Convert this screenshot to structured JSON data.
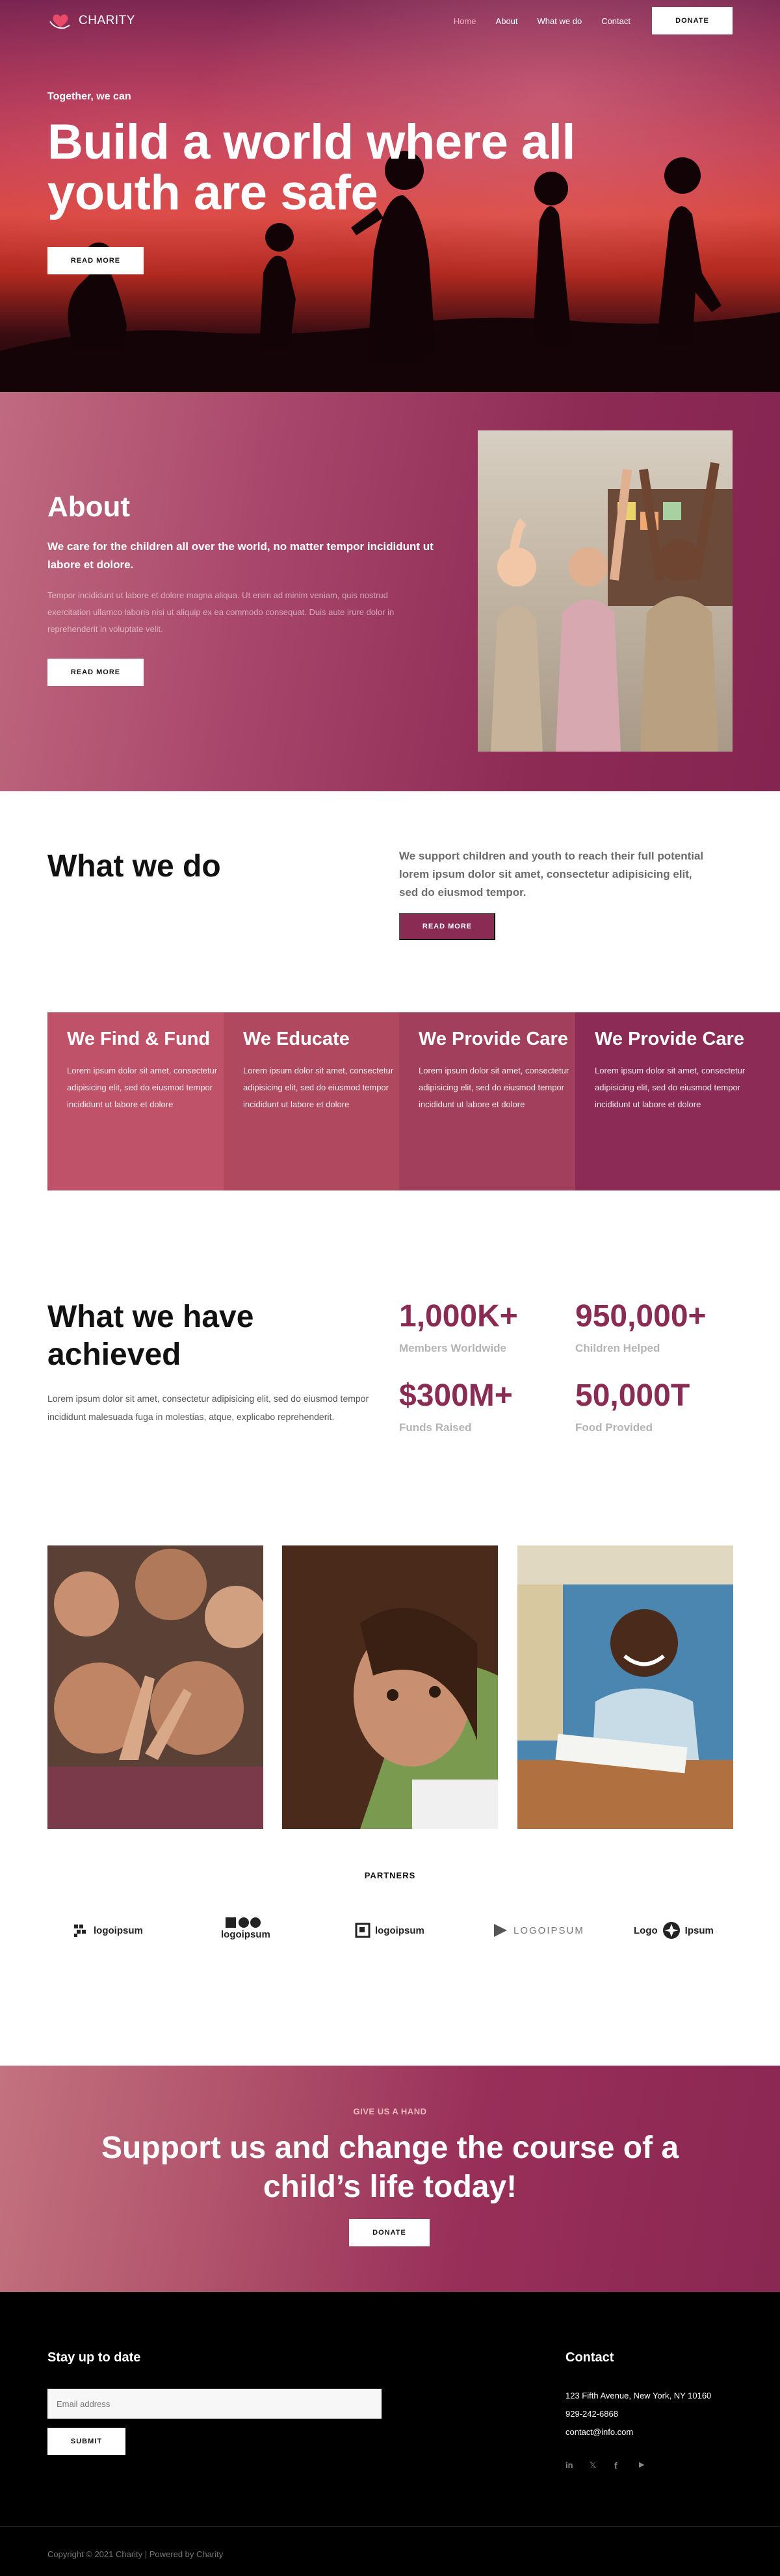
{
  "nav": {
    "logo_text": "CHARITY",
    "links": [
      "Home",
      "About",
      "What we do",
      "Contact"
    ],
    "donate_label": "DONATE"
  },
  "hero": {
    "eyebrow": "Together, we can",
    "title": "Build a world where all youth are safe",
    "button_label": "READ MORE"
  },
  "about": {
    "title": "About",
    "lead": "We care for the children all over the world, no matter tempor incididunt ut labore et dolore.",
    "body": "Tempor incididunt ut labore et dolore magna aliqua. Ut enim ad minim veniam, quis nostrud exercitation ullamco laboris nisi ut aliquip ex ea commodo consequat. Duis aute irure dolor in reprehenderit in voluptate velit.",
    "button_label": "READ MORE"
  },
  "what_we_do": {
    "title": "What we do",
    "text": "We support children and youth to reach their full potential lorem ipsum dolor sit amet, consectetur adipisicing elit, sed do eiusmod tempor.",
    "button_label": "READ MORE"
  },
  "services": [
    {
      "title": "We Find & Fund",
      "text": "Lorem ipsum dolor sit amet, consectetur adipisicing elit, sed do eiusmod tempor incididunt ut labore et dolore",
      "color": "#bf5169"
    },
    {
      "title": "We Educate",
      "text": "Lorem ipsum dolor sit amet, consectetur adipisicing elit, sed do eiusmod tempor incididunt ut labore et dolore",
      "color": "#b0495f"
    },
    {
      "title": "We Provide Care",
      "text": "Lorem ipsum dolor sit amet, consectetur adipisicing elit, sed do eiusmod tempor incididunt ut labore et dolore",
      "color": "#a23f5d"
    },
    {
      "title": "We Provide Care",
      "text": "Lorem ipsum dolor sit amet, consectetur adipisicing elit, sed do eiusmod tempor incididunt ut labore et dolore",
      "color": "#8c2b55"
    }
  ],
  "achieved": {
    "title": "What we have achieved",
    "text": "Lorem ipsum dolor sit amet, consectetur adipisicing elit, sed do eiusmod tempor incididunt malesuada fuga in molestias, atque, explicabo reprehenderit.",
    "stats": [
      {
        "value": "1,000K+",
        "label": "Members Worldwide"
      },
      {
        "value": "950,000+",
        "label": "Children Helped"
      },
      {
        "value": "$300M+",
        "label": "Funds Raised"
      },
      {
        "value": "50,000T",
        "label": "Food Provided"
      }
    ]
  },
  "partners": {
    "title": "PARTNERS",
    "logos": [
      "logoipsum",
      "logoipsum",
      "logoipsum",
      "LOGOIPSUM",
      "Ipsum"
    ]
  },
  "cta": {
    "eyebrow": "GIVE US A HAND",
    "title": "Support us and change the course of a child’s life today!",
    "button_label": "DONATE"
  },
  "footer": {
    "newsletter_title": "Stay up to date",
    "email_placeholder": "Email address",
    "submit_label": "SUBMIT",
    "contact_title": "Contact",
    "address": "123 Fifth Avenue, New York, NY 10160",
    "phone": "929-242-6868",
    "email": "contact@info.com",
    "social_icons": [
      "linkedin-icon",
      "twitter-icon",
      "facebook-icon",
      "youtube-icon"
    ],
    "social_glyphs": [
      "in",
      "𝕏",
      "f",
      "▶"
    ],
    "copyright": "Copyright © 2021 Charity | Powered by Charity"
  }
}
